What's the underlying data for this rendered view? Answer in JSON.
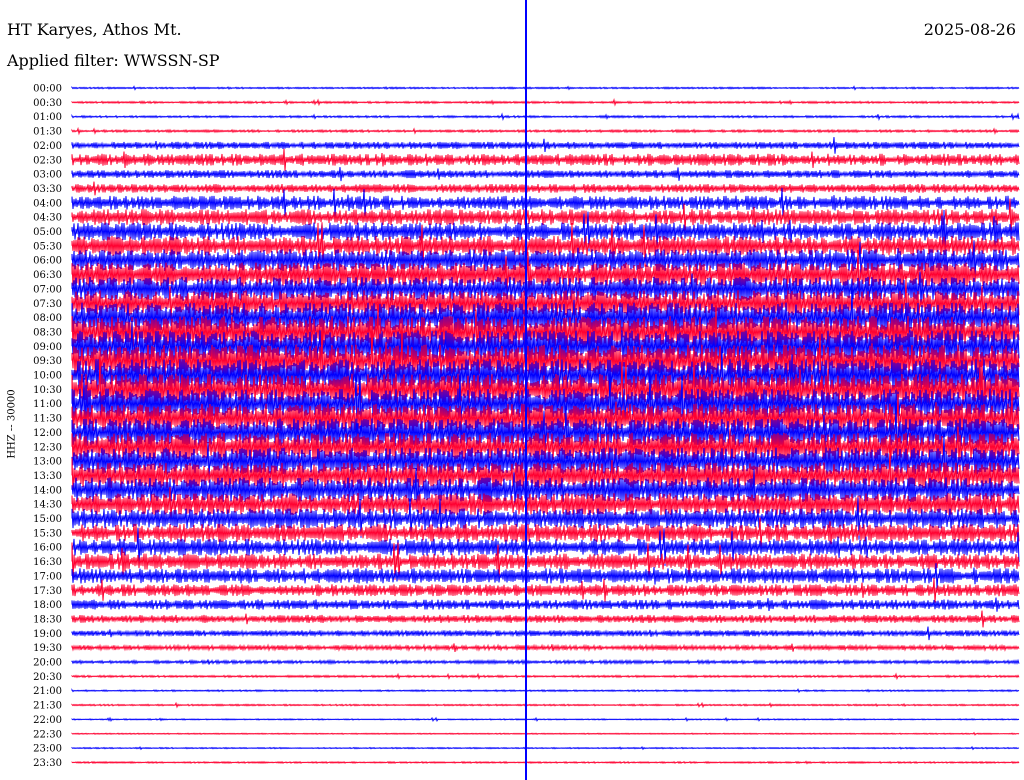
{
  "header": {
    "station": "HT Karyes, Athos Mt.",
    "filter": "Applied filter: WWSSN-SP",
    "date": "2025-08-26"
  },
  "chart_data": {
    "type": "line",
    "ylabel": "HHZ -- 30000",
    "categories": [
      "00:00",
      "00:30",
      "01:00",
      "01:30",
      "02:00",
      "02:30",
      "03:00",
      "03:30",
      "04:00",
      "04:30",
      "05:00",
      "05:30",
      "06:00",
      "06:30",
      "07:00",
      "07:30",
      "08:00",
      "08:30",
      "09:00",
      "09:30",
      "10:00",
      "10:30",
      "11:00",
      "11:30",
      "12:00",
      "12:30",
      "13:00",
      "13:30",
      "14:00",
      "14:30",
      "15:00",
      "15:30",
      "16:00",
      "16:30",
      "17:00",
      "17:30",
      "18:00",
      "18:30",
      "19:00",
      "19:30",
      "20:00",
      "20:30",
      "21:00",
      "21:30",
      "22:00",
      "22:30",
      "23:00",
      "23:30"
    ],
    "trace_colors": [
      "#0000ff",
      "#ff0030"
    ],
    "current_time_marker": "#0000ff",
    "noise_level": [
      0.04,
      0.05,
      0.05,
      0.06,
      0.18,
      0.3,
      0.2,
      0.22,
      0.35,
      0.4,
      0.45,
      0.5,
      0.55,
      0.6,
      0.6,
      0.65,
      0.75,
      0.8,
      0.8,
      0.8,
      0.8,
      0.78,
      0.75,
      0.72,
      0.7,
      0.7,
      0.68,
      0.65,
      0.62,
      0.55,
      0.5,
      0.45,
      0.42,
      0.4,
      0.38,
      0.3,
      0.25,
      0.2,
      0.15,
      0.12,
      0.08,
      0.05,
      0.04,
      0.04,
      0.03,
      0.03,
      0.03,
      0.04
    ]
  }
}
